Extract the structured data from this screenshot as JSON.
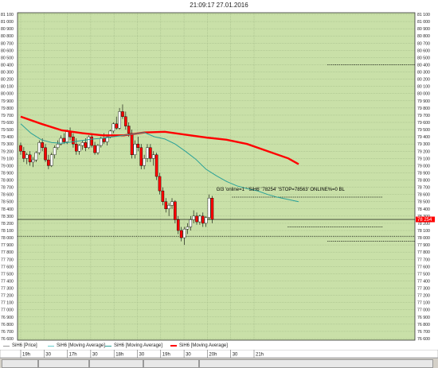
{
  "window": {
    "title": "21:09:17 27.01.2016"
  },
  "colors": {
    "background": "#d4d0c8",
    "plot": "#c9e0a8",
    "grid": "#8fa878",
    "up": "#ffffff",
    "down": "#ff0000",
    "ma_fast": "#2aa198",
    "ma_slow": "#ff0000",
    "price_marker": "#ff0000"
  },
  "legend": [
    {
      "label": "SiH6 [Price]",
      "color": "#999999"
    },
    {
      "label": "SiH6 [Moving Average]",
      "color": "#66cccc"
    },
    {
      "label": "SiH6 [Moving Average]",
      "color": "#2aa198"
    },
    {
      "label": "SiH6 [Moving Average]",
      "color": "#ff0000"
    }
  ],
  "annotation": "GI3 'online=1 ' 'SiH6' '78254' 'STOP=78563' ONLINE%=0 BL",
  "price_marker": {
    "value": 78254,
    "label": "78 254"
  },
  "chart_data": {
    "type": "candlestick",
    "title": "",
    "ylim": [
      76600,
      81100
    ],
    "y_step": 100,
    "x_ticks": [
      "19h",
      "30",
      "17h",
      "30",
      "18h",
      "30",
      "19h",
      "30",
      "20h",
      "30",
      "21h"
    ],
    "horizontal_levels": [
      {
        "value": 80400,
        "style": "dotted",
        "from": 0.78,
        "to": 1.0
      },
      {
        "value": 78563,
        "style": "dotted",
        "from": 0.54,
        "to": 0.92
      },
      {
        "value": 78254,
        "style": "solid",
        "from": 0.0,
        "to": 1.0
      },
      {
        "value": 78020,
        "style": "dotted",
        "from": 0.0,
        "to": 1.0
      },
      {
        "value": 77950,
        "style": "dotted",
        "from": 0.78,
        "to": 1.0
      },
      {
        "value": 78150,
        "style": "dotted",
        "from": 0.68,
        "to": 0.92
      }
    ],
    "ma_slow": [
      [
        0,
        79680
      ],
      [
        20,
        79580
      ],
      [
        40,
        79490
      ],
      [
        60,
        79450
      ],
      [
        80,
        79420
      ],
      [
        100,
        79420
      ],
      [
        120,
        79460
      ],
      [
        140,
        79470
      ],
      [
        160,
        79430
      ],
      [
        180,
        79390
      ],
      [
        200,
        79360
      ],
      [
        220,
        79300
      ],
      [
        240,
        79200
      ],
      [
        260,
        79100
      ],
      [
        270,
        79020
      ]
    ],
    "ma_fast": [
      [
        0,
        79580
      ],
      [
        10,
        79450
      ],
      [
        20,
        79360
      ],
      [
        30,
        79320
      ],
      [
        40,
        79310
      ],
      [
        50,
        79330
      ],
      [
        60,
        79350
      ],
      [
        70,
        79370
      ],
      [
        80,
        79380
      ],
      [
        90,
        79400
      ],
      [
        100,
        79420
      ],
      [
        110,
        79440
      ],
      [
        120,
        79460
      ],
      [
        130,
        79400
      ],
      [
        140,
        79370
      ],
      [
        150,
        79300
      ],
      [
        160,
        79200
      ],
      [
        170,
        79090
      ],
      [
        180,
        78950
      ],
      [
        190,
        78860
      ],
      [
        200,
        78780
      ],
      [
        210,
        78720
      ],
      [
        220,
        78680
      ],
      [
        230,
        78650
      ],
      [
        240,
        78600
      ],
      [
        250,
        78560
      ],
      [
        260,
        78530
      ],
      [
        270,
        78500
      ]
    ],
    "candles": [
      [
        0,
        79280,
        79320,
        79150,
        79200
      ],
      [
        3,
        79200,
        79260,
        79050,
        79100
      ],
      [
        6,
        79100,
        79180,
        79020,
        79150
      ],
      [
        9,
        79150,
        79200,
        79000,
        79050
      ],
      [
        12,
        79050,
        79120,
        78980,
        79080
      ],
      [
        15,
        79080,
        79200,
        79050,
        79180
      ],
      [
        18,
        79180,
        79350,
        79150,
        79320
      ],
      [
        21,
        79320,
        79380,
        79200,
        79250
      ],
      [
        24,
        79250,
        79300,
        79050,
        79080
      ],
      [
        27,
        79080,
        79150,
        78950,
        79000
      ],
      [
        30,
        79000,
        79180,
        78980,
        79150
      ],
      [
        33,
        79150,
        79280,
        79100,
        79250
      ],
      [
        36,
        79250,
        79350,
        79220,
        79300
      ],
      [
        39,
        79300,
        79420,
        79280,
        79380
      ],
      [
        42,
        79380,
        79450,
        79300,
        79330
      ],
      [
        45,
        79330,
        79500,
        79300,
        79480
      ],
      [
        48,
        79480,
        79530,
        79350,
        79400
      ],
      [
        51,
        79400,
        79450,
        79250,
        79300
      ],
      [
        54,
        79300,
        79380,
        79150,
        79200
      ],
      [
        57,
        79200,
        79300,
        79150,
        79280
      ],
      [
        60,
        79280,
        79350,
        79220,
        79320
      ],
      [
        63,
        79320,
        79380,
        79200,
        79250
      ],
      [
        66,
        79250,
        79420,
        79230,
        79400
      ],
      [
        69,
        79400,
        79450,
        79250,
        79280
      ],
      [
        72,
        79280,
        79330,
        79150,
        79180
      ],
      [
        75,
        79180,
        79300,
        79150,
        79280
      ],
      [
        78,
        79280,
        79400,
        79250,
        79380
      ],
      [
        81,
        79380,
        79450,
        79300,
        79330
      ],
      [
        84,
        79330,
        79420,
        79280,
        79400
      ],
      [
        87,
        79400,
        79500,
        79380,
        79480
      ],
      [
        90,
        79480,
        79600,
        79450,
        79580
      ],
      [
        93,
        79580,
        79680,
        79500,
        79520
      ],
      [
        96,
        79520,
        79800,
        79500,
        79750
      ],
      [
        99,
        79750,
        79850,
        79650,
        79680
      ],
      [
        102,
        79680,
        79750,
        79500,
        79550
      ],
      [
        105,
        79550,
        79600,
        79400,
        79450
      ],
      [
        108,
        79450,
        79500,
        79100,
        79150
      ],
      [
        111,
        79150,
        79350,
        79100,
        79300
      ],
      [
        114,
        79300,
        79400,
        79200,
        79250
      ],
      [
        117,
        79250,
        79300,
        78950,
        79000
      ],
      [
        120,
        79000,
        79150,
        78950,
        79100
      ],
      [
        123,
        79100,
        79300,
        79050,
        79250
      ],
      [
        126,
        79250,
        79300,
        79050,
        79100
      ],
      [
        129,
        79100,
        79200,
        79000,
        79150
      ],
      [
        132,
        79150,
        79180,
        78800,
        78850
      ],
      [
        135,
        78850,
        78900,
        78600,
        78650
      ],
      [
        138,
        78650,
        78700,
        78450,
        78500
      ],
      [
        141,
        78500,
        78550,
        78350,
        78400
      ],
      [
        144,
        78400,
        78480,
        78300,
        78450
      ],
      [
        147,
        78450,
        78550,
        78400,
        78500
      ],
      [
        150,
        78500,
        78520,
        78200,
        78250
      ],
      [
        153,
        78250,
        78300,
        78050,
        78100
      ],
      [
        156,
        78100,
        78150,
        77950,
        78000
      ],
      [
        159,
        78000,
        78150,
        77900,
        78120
      ],
      [
        162,
        78120,
        78200,
        78050,
        78150
      ],
      [
        165,
        78150,
        78300,
        78100,
        78250
      ],
      [
        168,
        78250,
        78380,
        78200,
        78300
      ],
      [
        171,
        78300,
        78350,
        78180,
        78220
      ],
      [
        174,
        78220,
        78320,
        78180,
        78300
      ],
      [
        177,
        78300,
        78350,
        78150,
        78200
      ],
      [
        180,
        78200,
        78300,
        78150,
        78280
      ],
      [
        183,
        78280,
        78600,
        78250,
        78550
      ],
      [
        186,
        78550,
        78580,
        78200,
        78254
      ]
    ],
    "x_max": 270
  },
  "statusbar": {
    "cells": 5
  }
}
